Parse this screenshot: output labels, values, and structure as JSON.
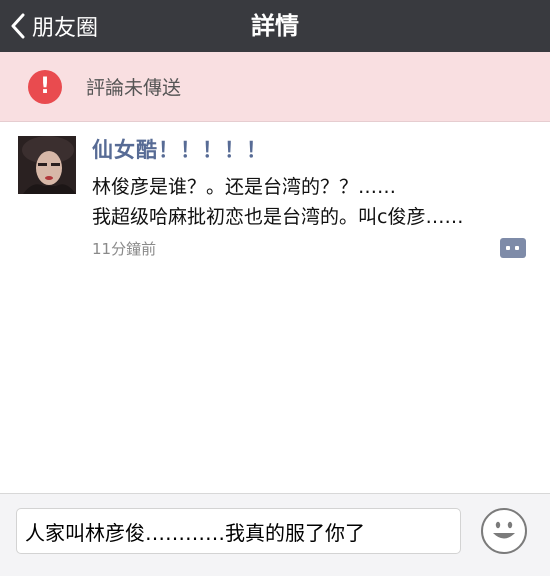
{
  "navbar": {
    "back_label": "朋友圈",
    "title": "詳情"
  },
  "error_bar": {
    "icon_glyph": "!",
    "message": "評論未傳送"
  },
  "comment": {
    "author": "仙女酷！！！！！",
    "lines": [
      "林俊彦是谁？。还是台湾的？？……",
      "我超级哈麻批初恋也是台湾的。叫c俊彦……"
    ],
    "time": "11分鐘前"
  },
  "input": {
    "value": "人家叫林彦俊…………我真的服了你了"
  },
  "colors": {
    "navbar": "#393a3f",
    "error_bg": "#f9dfe1",
    "error_icon": "#e94b4f",
    "author": "#576b95"
  }
}
